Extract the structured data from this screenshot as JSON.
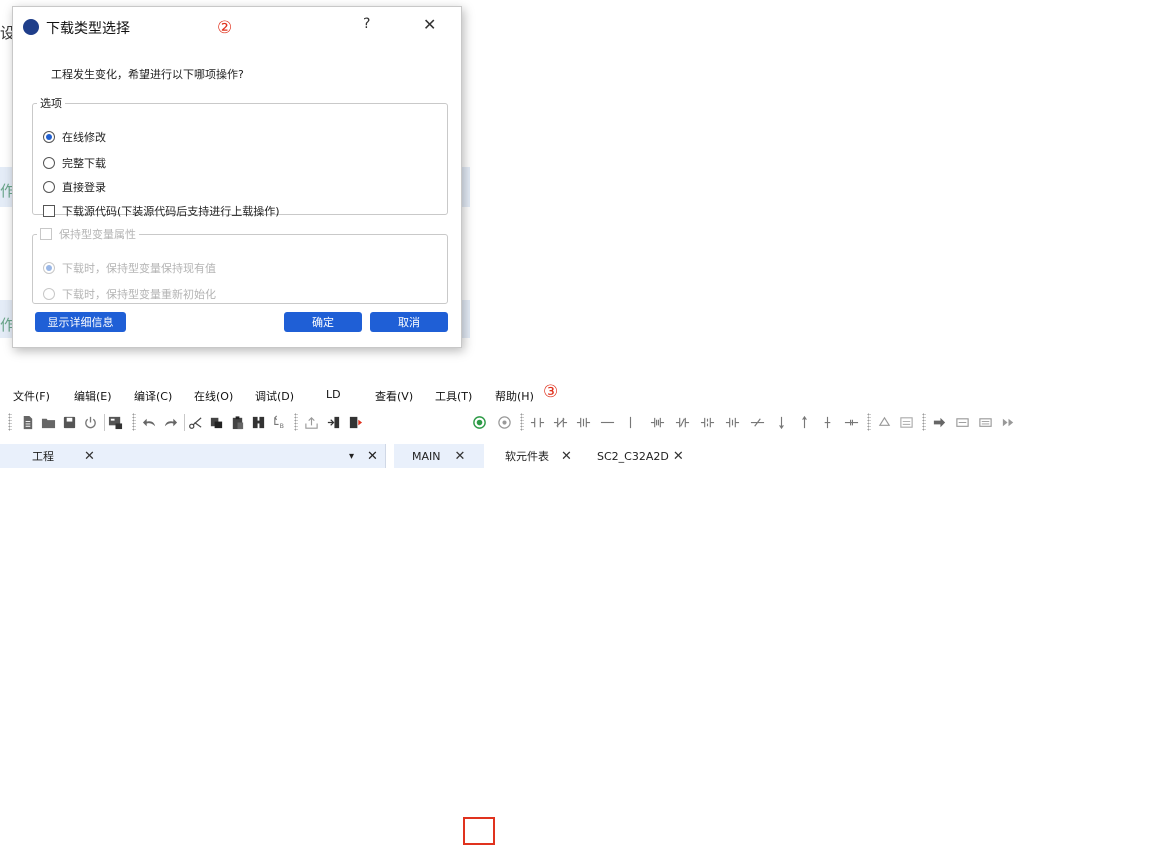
{
  "dialog": {
    "title": "下载类型选择",
    "annotation": "②",
    "help": "?",
    "close": "✕",
    "message": "工程发生变化，希望进行以下哪项操作?",
    "options_group": {
      "legend": "选项",
      "items": [
        {
          "label": "在线修改",
          "selected": true
        },
        {
          "label": "完整下载",
          "selected": false
        },
        {
          "label": "直接登录",
          "selected": false
        }
      ],
      "download_source_label": "下载源代码(下装源代码后支持进行上载操作)"
    },
    "retain_group": {
      "legend": "保持型变量属性",
      "items": [
        {
          "label": "下载时，保持型变量保持现有值",
          "selected": true
        },
        {
          "label": "下载时，保持型变量重新初始化",
          "selected": false
        }
      ]
    },
    "details_button": "显示详细信息",
    "ok_button": "确定",
    "cancel_button": "取消"
  },
  "background": {
    "partial_chars": [
      "设",
      "作",
      "作"
    ]
  },
  "menubar": {
    "items": [
      "文件(F)",
      "编辑(E)",
      "编译(C)",
      "在线(O)",
      "调试(D)",
      "LD",
      "查看(V)",
      "工具(T)",
      "帮助(H)"
    ],
    "annotation": "③"
  },
  "toolbar": {
    "icons": [
      "new-file-icon",
      "open-folder-icon",
      "save-icon",
      "power-icon",
      "compile-icon",
      "undo-icon",
      "redo-icon",
      "cut-icon",
      "copy-icon",
      "paste-icon",
      "find-icon",
      "replace-icon",
      "upload-icon",
      "download-icon",
      "download-run-icon",
      "login-icon",
      "logout-icon",
      "ld-contact-icon"
    ],
    "highlighted": "login-icon"
  },
  "tabs": {
    "workspace": "工程",
    "workspace_close": "✕",
    "dropdown": "▾",
    "panel_close": "✕",
    "editor_tabs": [
      {
        "label": "MAIN",
        "close": "✕"
      },
      {
        "label": "软元件表",
        "close": "✕"
      },
      {
        "label": "SC2_C32A2D",
        "close": "✕"
      }
    ]
  },
  "colors": {
    "accent_blue": "#1f5fd6",
    "annotation_red": "#e0321e",
    "logo_blue": "#1f3e8a"
  }
}
